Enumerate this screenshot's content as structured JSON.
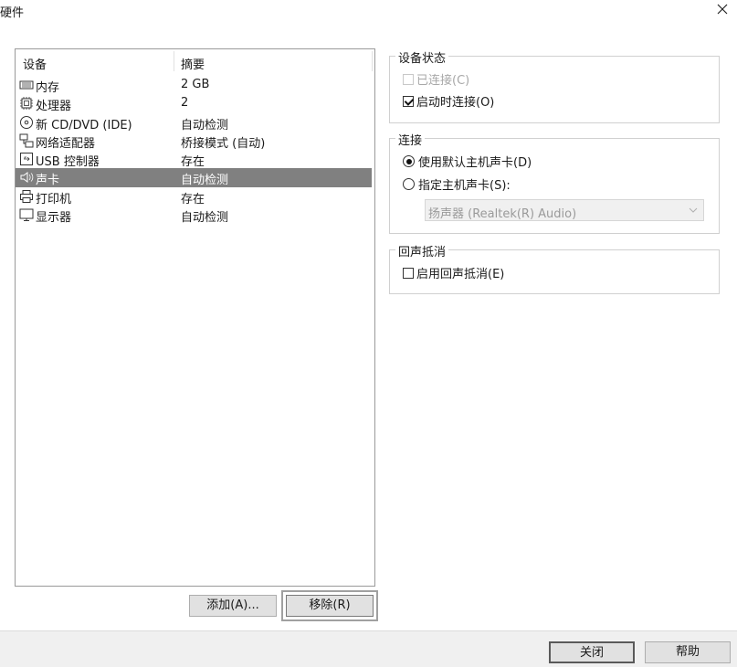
{
  "window": {
    "title": "硬件"
  },
  "device_list": {
    "columns": {
      "device": "设备",
      "summary": "摘要"
    },
    "rows": [
      {
        "icon": "memory-icon",
        "name": "内存",
        "summary": "2 GB",
        "selected": false
      },
      {
        "icon": "processor-icon",
        "name": "处理器",
        "summary": "2",
        "selected": false
      },
      {
        "icon": "cd-dvd-icon",
        "name": "新 CD/DVD (IDE)",
        "summary": "自动检测",
        "selected": false
      },
      {
        "icon": "network-adapter-icon",
        "name": "网络适配器",
        "summary": "桥接模式 (自动)",
        "selected": false
      },
      {
        "icon": "usb-controller-icon",
        "name": "USB 控制器",
        "summary": "存在",
        "selected": false
      },
      {
        "icon": "speaker-icon",
        "name": "声卡",
        "summary": "自动检测",
        "selected": true
      },
      {
        "icon": "printer-icon",
        "name": "打印机",
        "summary": "存在",
        "selected": false
      },
      {
        "icon": "display-icon",
        "name": "显示器",
        "summary": "自动检测",
        "selected": false
      }
    ]
  },
  "list_buttons": {
    "add": "添加(A)...",
    "remove": "移除(R)"
  },
  "device_status": {
    "legend": "设备状态",
    "connected": {
      "label": "已连接(C)",
      "checked": false,
      "disabled": true
    },
    "connect_at_power_on": {
      "label": "启动时连接(O)",
      "checked": true
    }
  },
  "connection": {
    "legend": "连接",
    "use_default": {
      "label": "使用默认主机声卡(D)",
      "checked": true
    },
    "specify": {
      "label": "指定主机声卡(S):",
      "checked": false
    },
    "select_value": "扬声器 (Realtek(R) Audio)"
  },
  "echo_cancel": {
    "legend": "回声抵消",
    "enable": {
      "label": "启用回声抵消(E)",
      "checked": false
    }
  },
  "footer": {
    "close": "关闭",
    "help": "帮助"
  },
  "colors": {
    "selected_row": "#808080",
    "panel": "#ffffff",
    "chrome": "#f0f0f0"
  }
}
